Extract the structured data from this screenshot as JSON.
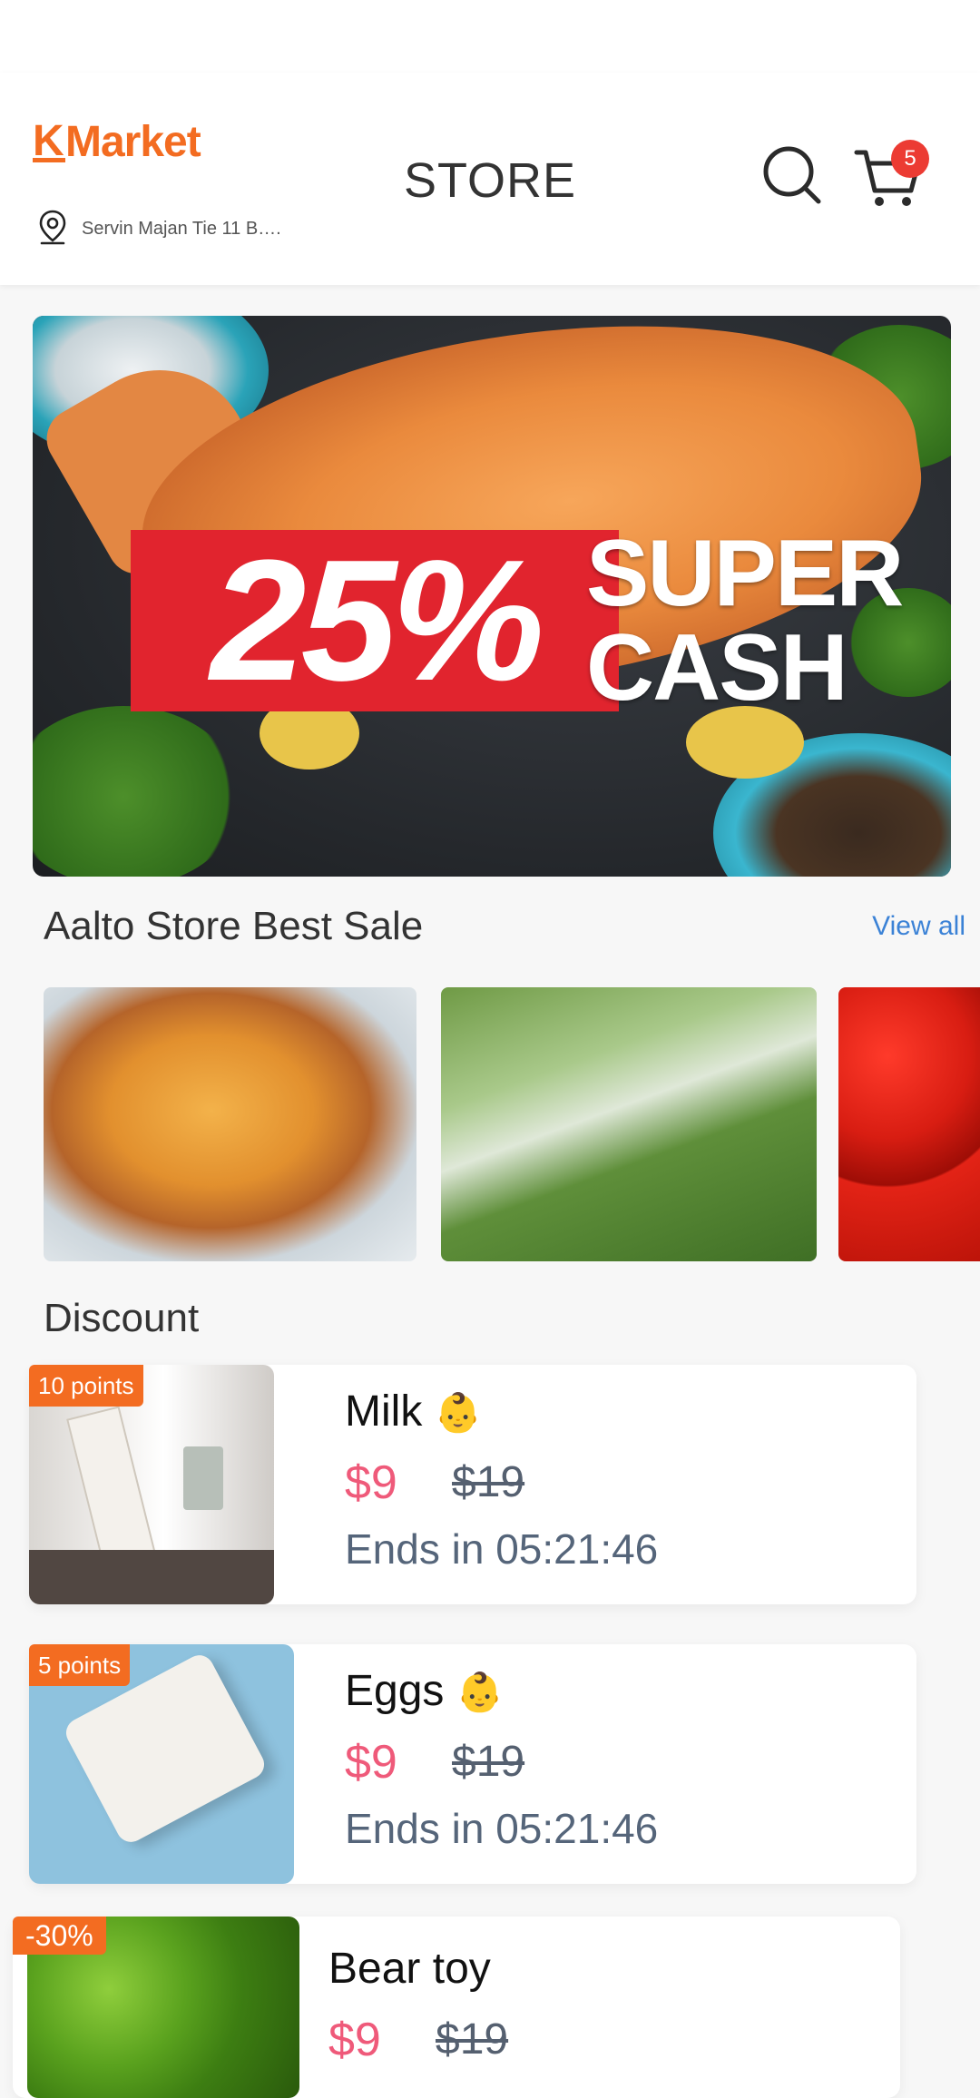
{
  "header": {
    "logo_text": "Market",
    "logo_k": "K",
    "location": "Servin Majan Tie 11 B….",
    "title": "STORE",
    "cart_count": "5"
  },
  "banner": {
    "percent": "25%",
    "word1": "SUPER",
    "word2": "CASH"
  },
  "best_sale": {
    "title": "Aalto Store Best Sale",
    "view_all": "View all",
    "items": [
      "fried-pancake-photo",
      "greens-photo",
      "tomatoes-photo"
    ]
  },
  "discount": {
    "title": "Discount",
    "items": [
      {
        "tag": "10 points",
        "name": "Milk",
        "emoji": "👶",
        "price": "$9",
        "old_price": "$19",
        "ends": "Ends in 05:21:46"
      },
      {
        "tag": "5 points",
        "name": "Eggs",
        "emoji": "👶",
        "price": "$9",
        "old_price": "$19",
        "ends": "Ends in 05:21:46"
      },
      {
        "tag": "-30%",
        "name": "Bear toy",
        "price": "$9",
        "old_price": "$19"
      }
    ]
  },
  "colors": {
    "brand": "#f36c21",
    "badge": "#ec3b33",
    "price": "#ef5a7a",
    "link": "#3b82d6"
  }
}
